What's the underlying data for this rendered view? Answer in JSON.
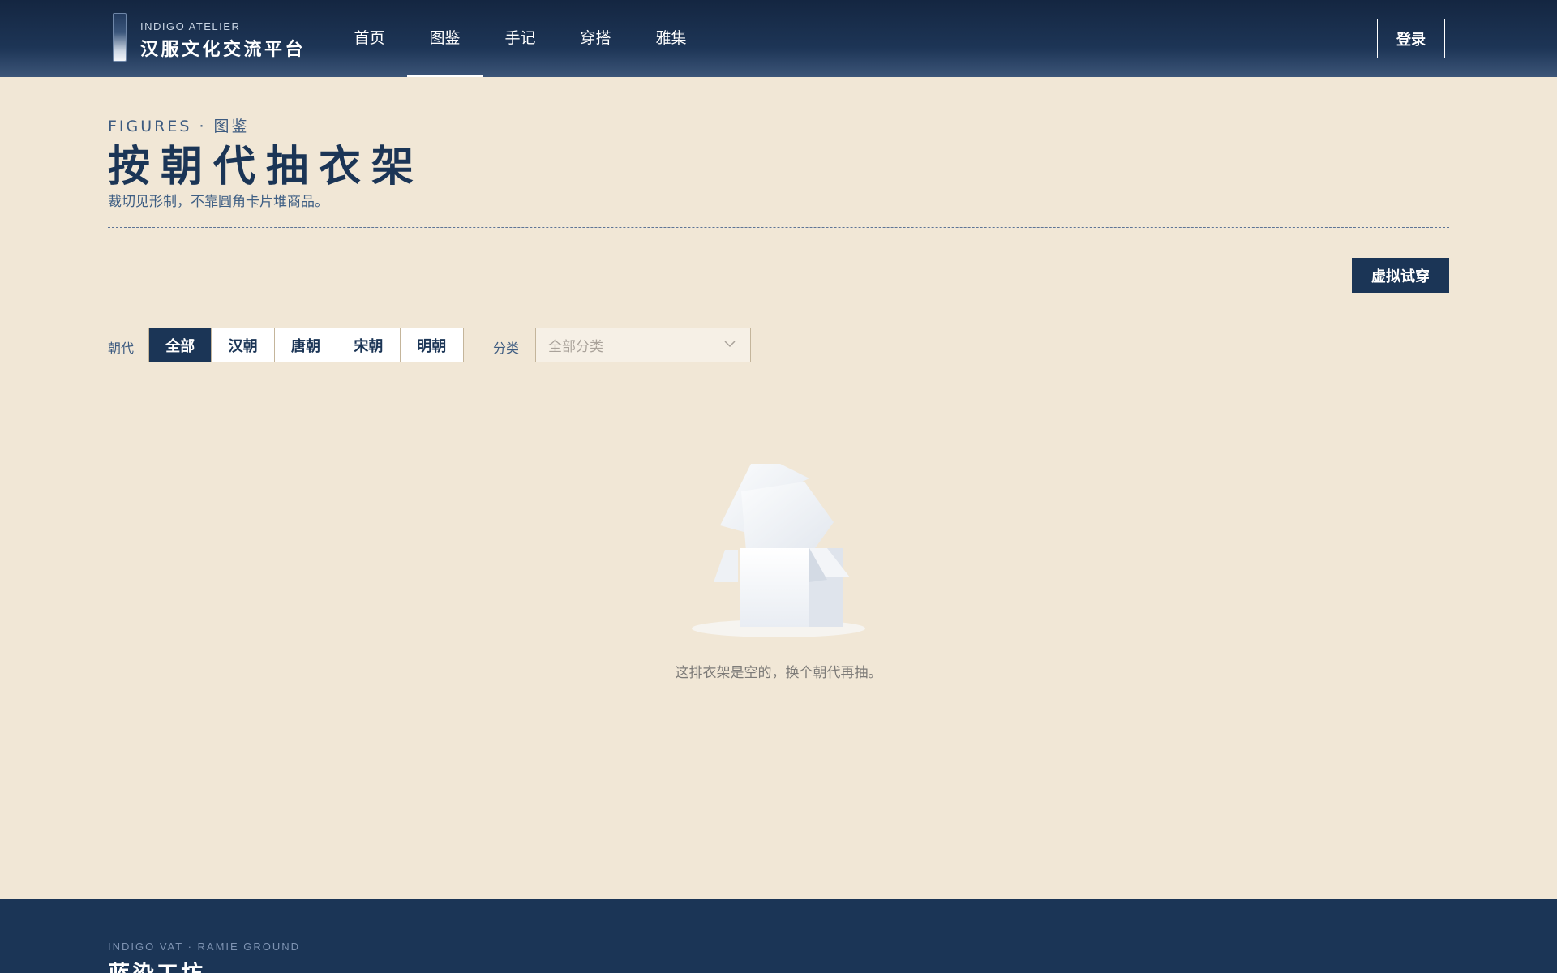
{
  "header": {
    "logo_en": "INDIGO ATELIER",
    "logo_cn": "汉服文化交流平台",
    "nav": [
      {
        "label": "首页",
        "active": false
      },
      {
        "label": "图鉴",
        "active": true
      },
      {
        "label": "手记",
        "active": false
      },
      {
        "label": "穿搭",
        "active": false
      },
      {
        "label": "雅集",
        "active": false
      }
    ],
    "login_label": "登录"
  },
  "intro": {
    "eyebrow": "FIGURES · 图鉴",
    "title": "按朝代抽衣架",
    "subtitle": "裁切见形制，不靠圆角卡片堆商品。"
  },
  "actions": {
    "virtual_tryon_label": "虚拟试穿"
  },
  "filters": {
    "dynasty_label": "朝代",
    "dynasties": [
      {
        "label": "全部",
        "active": true
      },
      {
        "label": "汉朝",
        "active": false
      },
      {
        "label": "唐朝",
        "active": false
      },
      {
        "label": "宋朝",
        "active": false
      },
      {
        "label": "明朝",
        "active": false
      }
    ],
    "category_label": "分类",
    "category_placeholder": "全部分类"
  },
  "empty_state": {
    "icon": "empty-box-icon",
    "message": "这排衣架是空的，换个朝代再抽。"
  },
  "footer": {
    "eyebrow": "INDIGO VAT · RAMIE GROUND",
    "title": "蓝染工坊"
  },
  "colors": {
    "page_bg": "#f1e7d6",
    "navy": "#1b3556",
    "header_top": "#142641",
    "accent_text": "#3d5b80",
    "muted": "#7d7b78",
    "border": "#c4b59b"
  }
}
